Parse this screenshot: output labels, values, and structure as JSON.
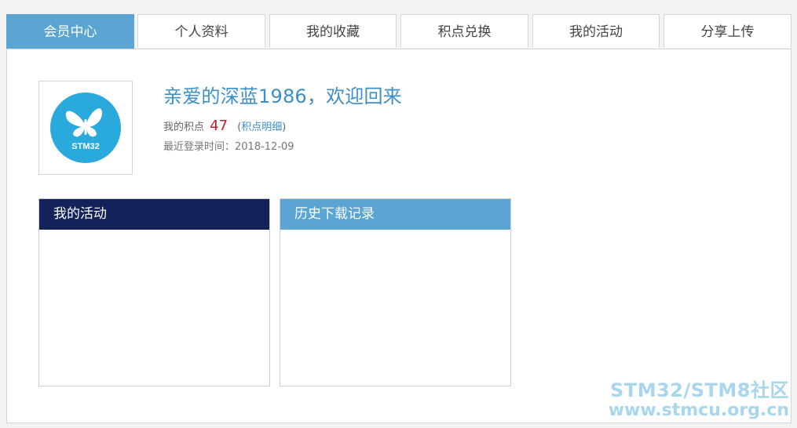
{
  "tabs": [
    {
      "label": "会员中心",
      "active": true
    },
    {
      "label": "个人资料"
    },
    {
      "label": "我的收藏"
    },
    {
      "label": "积点兑换"
    },
    {
      "label": "我的活动"
    },
    {
      "label": "分享上传"
    }
  ],
  "profile": {
    "avatar_text": "STM32",
    "welcome": "亲爱的深蓝1986，欢迎回来",
    "points_label": "我的积点",
    "points_value": "47",
    "points_link_open": "(",
    "points_link": "积点明细",
    "points_link_close": ")",
    "last_login": "最近登录时间：2018-12-09"
  },
  "boxes": {
    "activities_title": "我的活动",
    "downloads_title": "历史下载记录"
  },
  "watermark": {
    "line1": "STM32/STM8社区",
    "line2": "www.stmcu.org.cn"
  },
  "colors": {
    "accent": "#5aa5d1",
    "navy": "#14225a",
    "link": "#3b8fc6",
    "points": "#c0202a"
  }
}
